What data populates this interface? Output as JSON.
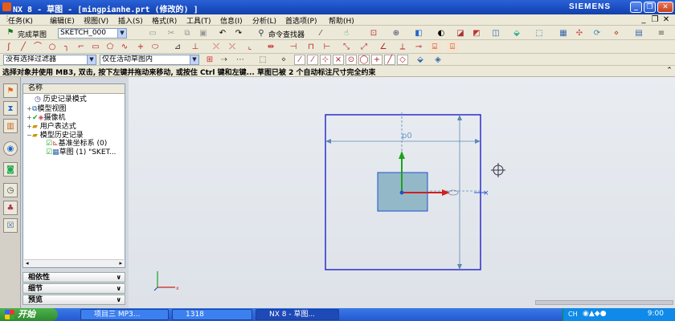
{
  "window": {
    "title": "NX 8 - 草图 - [mingpianhe.prt  (修改的) ]",
    "brand": "SIEMENS",
    "minimize": "_",
    "restore": "❐",
    "close": "✕"
  },
  "menubar": {
    "items": [
      "任务(K)",
      "编辑(E)",
      "视图(V)",
      "插入(S)",
      "格式(R)",
      "工具(T)",
      "信息(I)",
      "分析(L)",
      "首选项(P)",
      "帮助(H)"
    ]
  },
  "toolbar1": {
    "finish_sketch_label": "完成草图",
    "sketch_name": "SKETCH_000",
    "command_finder_label": "命令查找器"
  },
  "toolbar3": {
    "filter_combo": "没有选择过滤器",
    "scope_combo": "仅在活动草图内"
  },
  "status": {
    "text": "选择对象并使用 MB3, 双击, 按下左键并拖动来移动, 或按住 Ctrl 键和左键...  草图已被 2 个自动标注尺寸完全约束"
  },
  "navigator": {
    "header": "名称",
    "nodes": [
      {
        "label": "历史记录模式"
      },
      {
        "label": "模型视图"
      },
      {
        "label": "摄像机"
      },
      {
        "label": "用户表达式"
      },
      {
        "label": "模型历史记录"
      },
      {
        "label": "基准坐标系 (0)"
      },
      {
        "label": "草图 (1) \"SKET..."
      }
    ]
  },
  "panels": [
    "相依性",
    "细节",
    "预览"
  ],
  "canvas": {
    "dim_label": "p0"
  },
  "taskbar": {
    "start": "开始",
    "tasks": [
      "项目三 MP3...",
      "1318",
      "NX 8 - 草图..."
    ],
    "lang": "CH",
    "clock": "9:00"
  },
  "colors": {
    "titlebar": "#1a4cc0",
    "sketch_outline": "#2020c8",
    "rect_fill": "#93b8c8",
    "axis_x": "#d02020",
    "axis_y": "#20a020",
    "axis_z": "#2050d0"
  }
}
